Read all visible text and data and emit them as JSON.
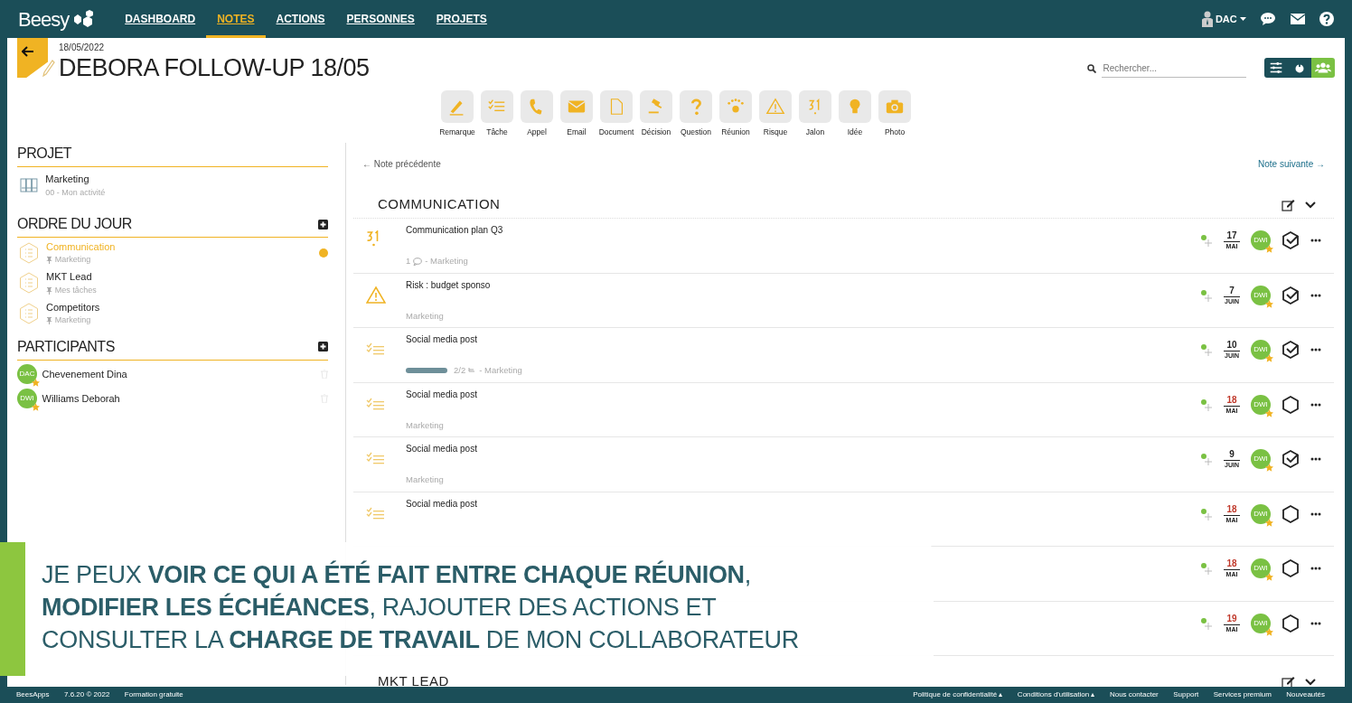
{
  "nav": {
    "logo": "Beesy",
    "items": [
      {
        "label": "DASHBOARD",
        "selected": false
      },
      {
        "label": "NOTES",
        "selected": true
      },
      {
        "label": "ACTIONS",
        "selected": false
      },
      {
        "label": "PERSONNES",
        "selected": false
      },
      {
        "label": "PROJETS",
        "selected": false
      }
    ],
    "user": "DAC"
  },
  "note": {
    "date": "18/05/2022",
    "title": "DEBORA FOLLOW-UP 18/05"
  },
  "search": {
    "placeholder": "Rechercher..."
  },
  "views": [
    {
      "selected": false
    },
    {
      "selected": false
    },
    {
      "selected": true
    }
  ],
  "toolbar": [
    "Remarque",
    "Tâche",
    "Appel",
    "Email",
    "Document",
    "Décision",
    "Question",
    "Réunion",
    "Risque",
    "Jalon",
    "Idée",
    "Photo"
  ],
  "sidebar": {
    "project_heading": "PROJET",
    "project": {
      "name": "Marketing",
      "sub": "00 - Mon activité"
    },
    "agenda_heading": "ORDRE DU JOUR",
    "agenda": [
      {
        "title": "Communication",
        "sub": "Marketing",
        "selected": true
      },
      {
        "title": "MKT Lead",
        "sub": "Mes tâches",
        "selected": false
      },
      {
        "title": "Competitors",
        "sub": "Marketing",
        "selected": false
      }
    ],
    "participants_heading": "PARTICIPANTS",
    "participants": [
      {
        "initials": "DAC",
        "name": "Chevenement Dina"
      },
      {
        "initials": "DWI",
        "name": "Williams Deborah"
      }
    ]
  },
  "pager": {
    "prev": "← Note précédente",
    "next": "Note suivante →"
  },
  "section": {
    "title": "COMMUNICATION"
  },
  "rows": [
    {
      "kind": "milestone",
      "title": "Communication plan Q3",
      "count": "1",
      "meta": "- Marketing",
      "day": "17",
      "month": "MAI",
      "overdue": false,
      "owner": "DWI",
      "done": true
    },
    {
      "kind": "risk",
      "title": "Risk : budget sponso",
      "meta": "Marketing",
      "day": "7",
      "month": "JUIN",
      "overdue": false,
      "owner": "DWI",
      "done": true
    },
    {
      "kind": "task",
      "title": "Social media post",
      "level": 1,
      "count": "2/2",
      "meta": "- Marketing",
      "day": "10",
      "month": "JUIN",
      "overdue": false,
      "owner": "DWI",
      "done": true
    },
    {
      "kind": "task",
      "title": "Social media post",
      "meta": "Marketing",
      "day": "18",
      "month": "MAI",
      "overdue": true,
      "owner": "DWI",
      "done": false
    },
    {
      "kind": "task",
      "title": "Social media post",
      "meta": "Marketing",
      "day": "9",
      "month": "JUIN",
      "overdue": false,
      "owner": "DWI",
      "done": true
    },
    {
      "kind": "task",
      "title": "Social media post",
      "day": "18",
      "month": "MAI",
      "overdue": true,
      "owner": "DWI",
      "done": false
    },
    {
      "day": "18",
      "month": "MAI",
      "overdue": true,
      "owner": "DWI",
      "done": false
    },
    {
      "day": "19",
      "month": "MAI",
      "overdue": true,
      "owner": "DWI",
      "done": false
    }
  ],
  "next_section": {
    "title": "MKT LEAD"
  },
  "banner": {
    "lines": [
      "JE PEUX **VOIR CE QUI A ÉTÉ FAIT ENTRE CHAQUE RÉUNION**,",
      "**MODIFIER LES ÉCHÉANCES**, RAJOUTER DES ACTIONS ET",
      "CONSULTER LA **CHARGE DE TRAVAIL** DE MON COLLABORATEUR"
    ]
  },
  "footer": {
    "left": [
      "BeesApps",
      "7.6.20 © 2022",
      "Formation gratuite"
    ],
    "right": [
      "Politique de confidentialité ▴",
      "Conditions d'utilisation ▴",
      "Nous contacter",
      "Support",
      "Services premium",
      "Nouveautés"
    ]
  }
}
